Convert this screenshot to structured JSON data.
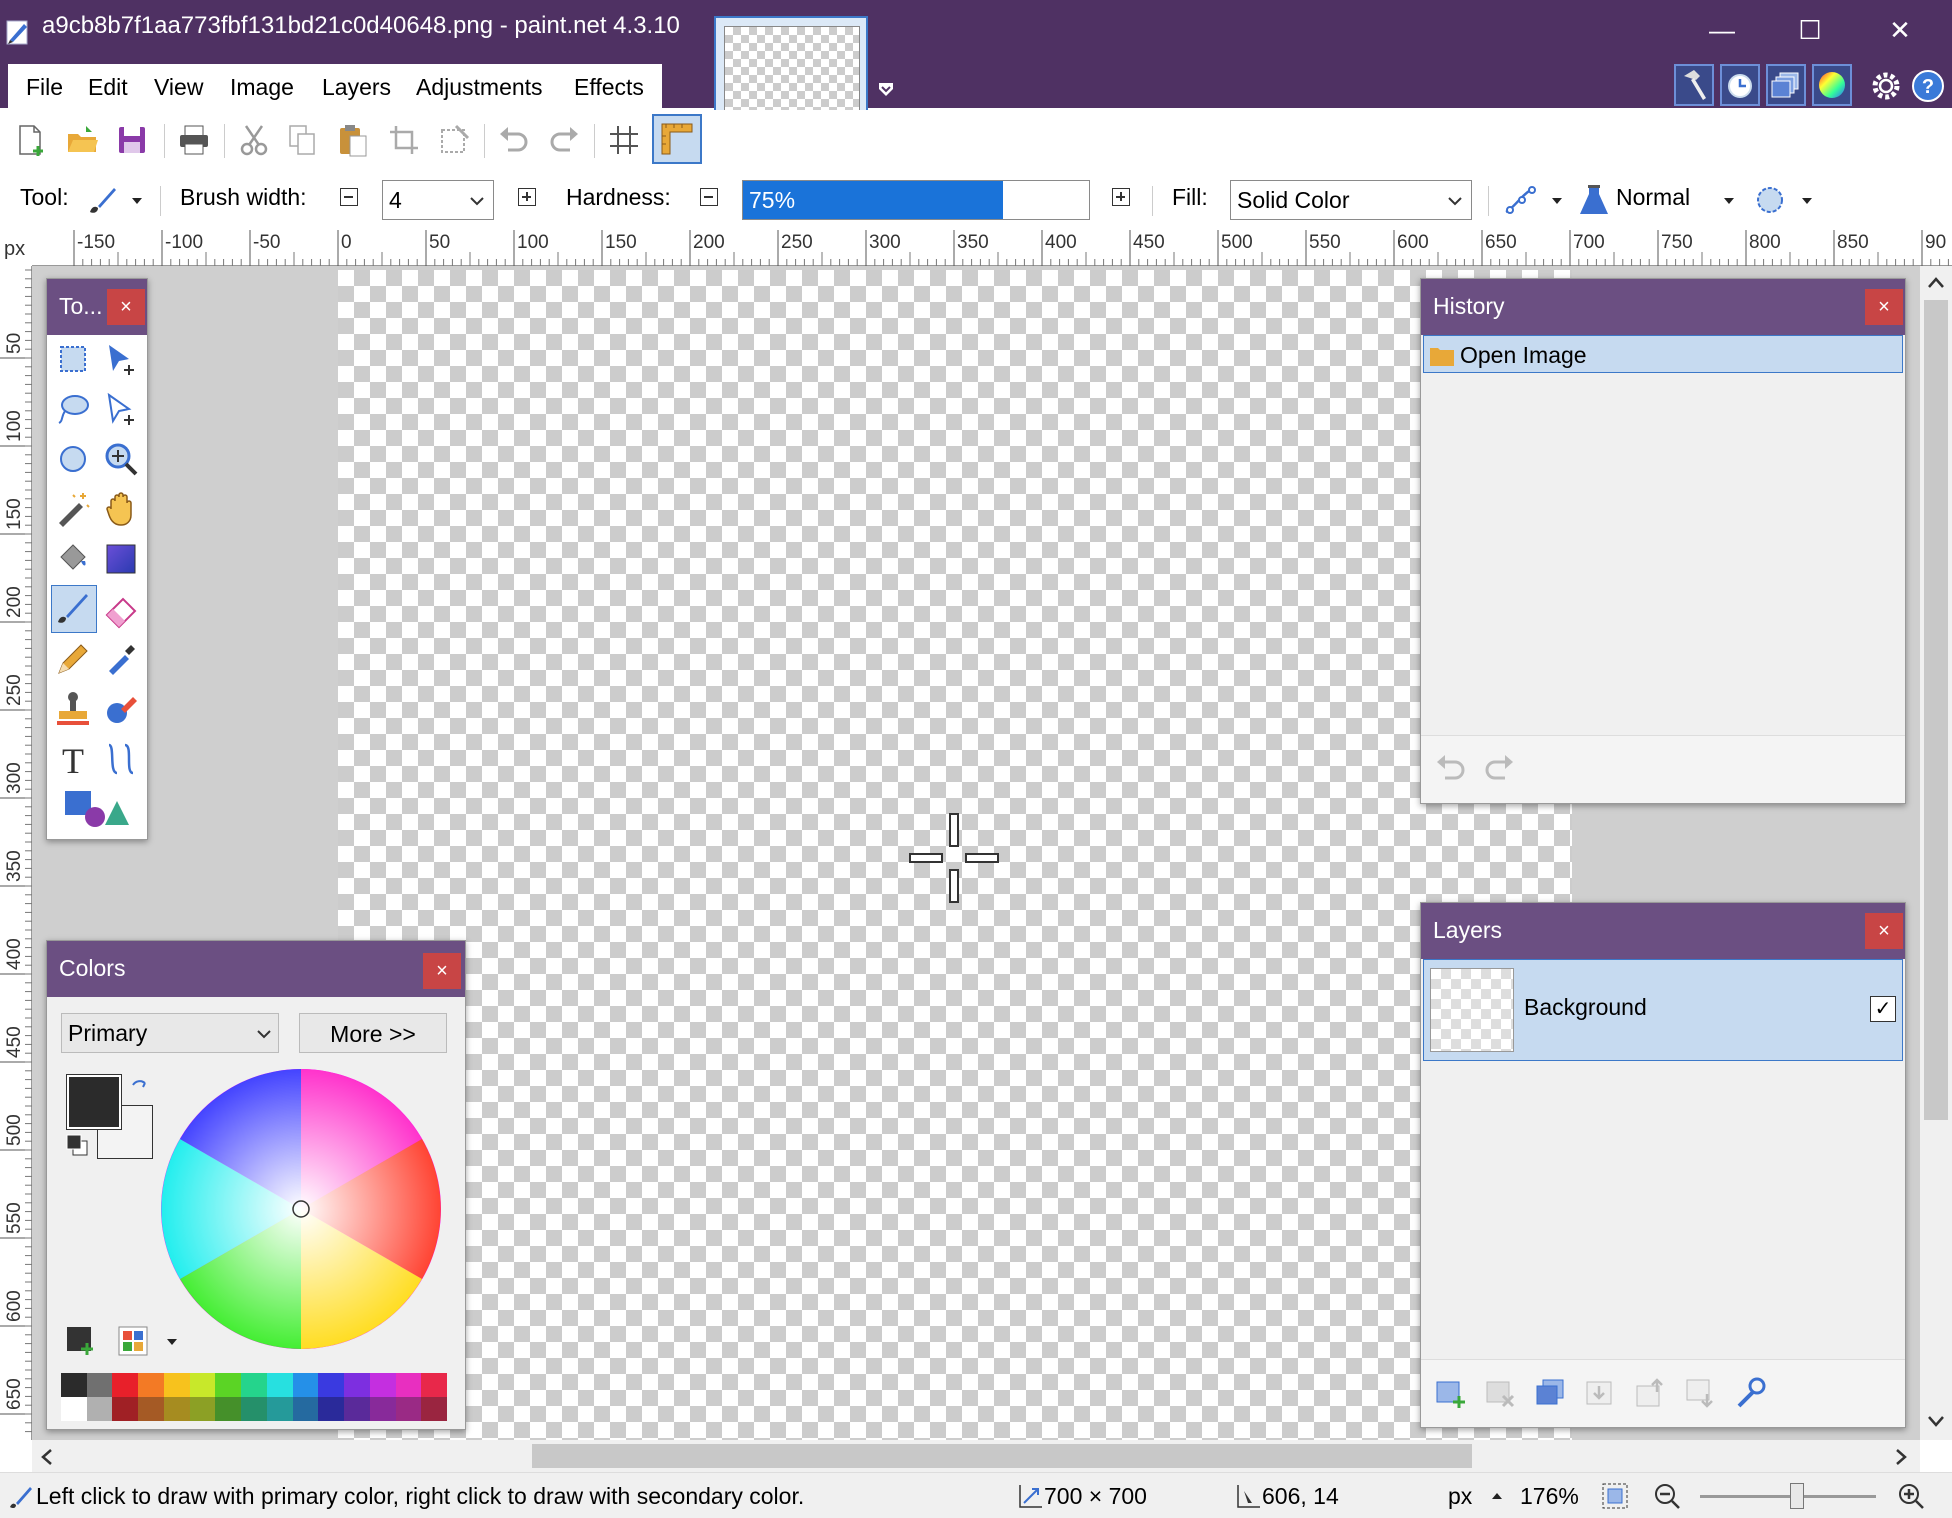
{
  "window": {
    "title": "a9cb8b7f1aa773fbf131bd21c0d40648.png - paint.net 4.3.10",
    "min": "—",
    "max": "☐",
    "close": "✕"
  },
  "menu": [
    "File",
    "Edit",
    "View",
    "Image",
    "Layers",
    "Adjustments",
    "Effects"
  ],
  "options": {
    "tool_label": "Tool:",
    "brush_width_label": "Brush width:",
    "brush_width_value": "4",
    "hardness_label": "Hardness:",
    "hardness_value": "75%",
    "hardness_fraction": 0.75,
    "fill_label": "Fill:",
    "fill_value": "Solid Color",
    "blend_mode": "Normal"
  },
  "ruler": {
    "unit": "px",
    "h_labels": [
      "-150",
      "-100",
      "-50",
      "0",
      "50",
      "100",
      "150",
      "200",
      "250",
      "300",
      "350",
      "400",
      "450",
      "500",
      "550",
      "600",
      "650",
      "700",
      "750",
      "800",
      "850",
      "90"
    ],
    "v_labels": [
      "50",
      "100",
      "150",
      "200",
      "250",
      "300",
      "350",
      "400",
      "450",
      "500",
      "550",
      "600",
      "650"
    ]
  },
  "tools_panel": {
    "title": "To...",
    "close": "×"
  },
  "history_panel": {
    "title": "History",
    "close": "×",
    "items": [
      "Open Image"
    ]
  },
  "layers_panel": {
    "title": "Layers",
    "close": "×",
    "items": [
      {
        "name": "Background",
        "visible_mark": "✓"
      }
    ]
  },
  "colors_panel": {
    "title": "Colors",
    "close": "×",
    "mode": "Primary",
    "more_label": "More >>",
    "primary_color": "#2b2b2b",
    "secondary_color": "#f3f3f3",
    "palette_top": [
      "#2b2b2b",
      "#707070",
      "#e8202a",
      "#f37a25",
      "#f7c21d",
      "#c8e82a",
      "#5bd425",
      "#25d48c",
      "#27e0e0",
      "#2590e8",
      "#3a3ae0",
      "#7d2fe0",
      "#c42fe0",
      "#e82fc0",
      "#e8284a"
    ],
    "palette_bottom": [
      "#ffffff",
      "#b0b0b0",
      "#a02025",
      "#a55a25",
      "#a68c20",
      "#8ca025",
      "#45902a",
      "#25906a",
      "#259a9a",
      "#256aa0",
      "#2a2a9a",
      "#5a2a9a",
      "#882a9a",
      "#9a2a85",
      "#9a2540"
    ]
  },
  "status": {
    "hint": "Left click to draw with primary color, right click to draw with secondary color.",
    "image_size": "700 × 700",
    "cursor_pos": "606, 14",
    "unit": "px",
    "zoom": "176%",
    "zoom_fraction": 0.55
  },
  "colors": {
    "title_bar": "#4f3163",
    "panel_header": "#6b4f82",
    "selection": "#c6daf0",
    "accent": "#1a73d9"
  }
}
